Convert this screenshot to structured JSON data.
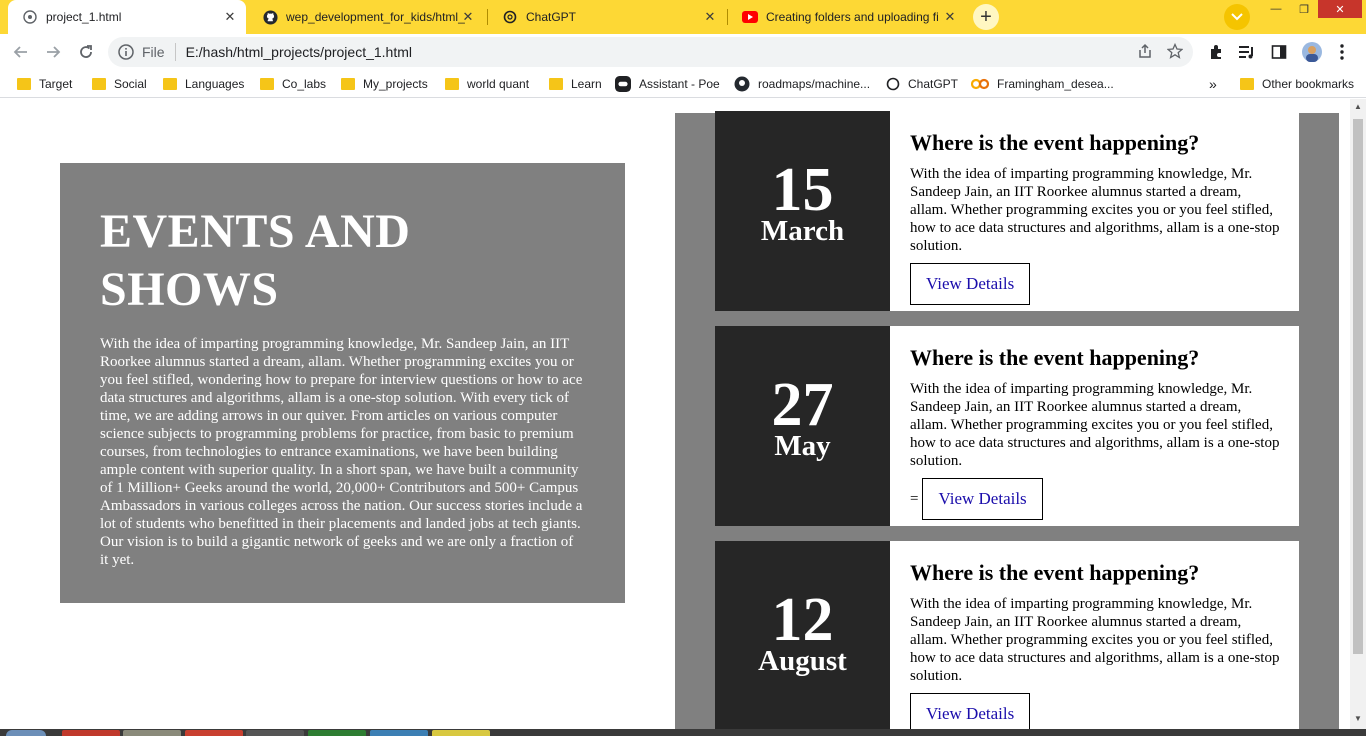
{
  "browser": {
    "tabs": [
      {
        "title": "project_1.html",
        "active": true
      },
      {
        "title": "wep_development_for_kids/html_",
        "active": false
      },
      {
        "title": "ChatGPT",
        "active": false
      },
      {
        "title": "Creating folders and uploading fi",
        "active": false
      }
    ],
    "new_tab_label": "+",
    "omnibox": {
      "scheme": "File",
      "url": "E:/hash/html_projects/project_1.html"
    },
    "bookmarks": [
      "Target",
      "Social",
      "Languages",
      "Co_labs",
      "My_projects",
      "world quant",
      "Learn",
      "Assistant - Poe",
      "roadmaps/machine...",
      "ChatGPT",
      "Framingham_desea..."
    ],
    "bookmarks_overflow": "»",
    "other_bookmarks": "Other bookmarks"
  },
  "page": {
    "hero": {
      "title": "EVENTS AND SHOWS",
      "body": "With the idea of imparting programming knowledge, Mr. Sandeep Jain, an IIT Roorkee alumnus started a dream, allam. Whether programming excites you or you feel stifled, wondering how to prepare for interview questions or how to ace data structures and algorithms, allam is a one-stop solution. With every tick of time, we are adding arrows in our quiver. From articles on various computer science subjects to programming problems for practice, from basic to premium courses, from technologies to entrance examinations, we have been building ample content with superior quality. In a short span, we have built a community of 1 Million+ Geeks around the world, 20,000+ Contributors and 500+ Campus Ambassadors in various colleges across the nation. Our success stories include a lot of students who benefitted in their placements and landed jobs at tech giants. Our vision is to build a gigantic network of geeks and we are only a fraction of it yet."
    },
    "events": [
      {
        "day": "15",
        "month": "March",
        "heading": "Where is the event happening?",
        "body": "With the idea of imparting programming knowledge, Mr. Sandeep Jain, an IIT Roorkee alumnus started a dream, allam. Whether programming excites you or you feel stifled, how to ace data structures and algorithms, allam is a one-stop solution.",
        "prefix": "",
        "button": "View Details"
      },
      {
        "day": "27",
        "month": "May",
        "heading": "Where is the event happening?",
        "body": "With the idea of imparting programming knowledge, Mr. Sandeep Jain, an IIT Roorkee alumnus started a dream, allam. Whether programming excites you or you feel stifled, how to ace data structures and algorithms, allam is a one-stop solution.",
        "prefix": "=",
        "button": "View Details"
      },
      {
        "day": "12",
        "month": "August",
        "heading": "Where is the event happening?",
        "body": "With the idea of imparting programming knowledge, Mr. Sandeep Jain, an IIT Roorkee alumnus started a dream, allam. Whether programming excites you or you feel stifled, how to ace data structures and algorithms, allam is a one-stop solution.",
        "prefix": "",
        "button": "View Details"
      }
    ]
  },
  "colors": {
    "tab_strip": "#fdd835",
    "panel_gray": "#808080",
    "date_dark": "#262626",
    "link_blue": "#1a0dab"
  }
}
